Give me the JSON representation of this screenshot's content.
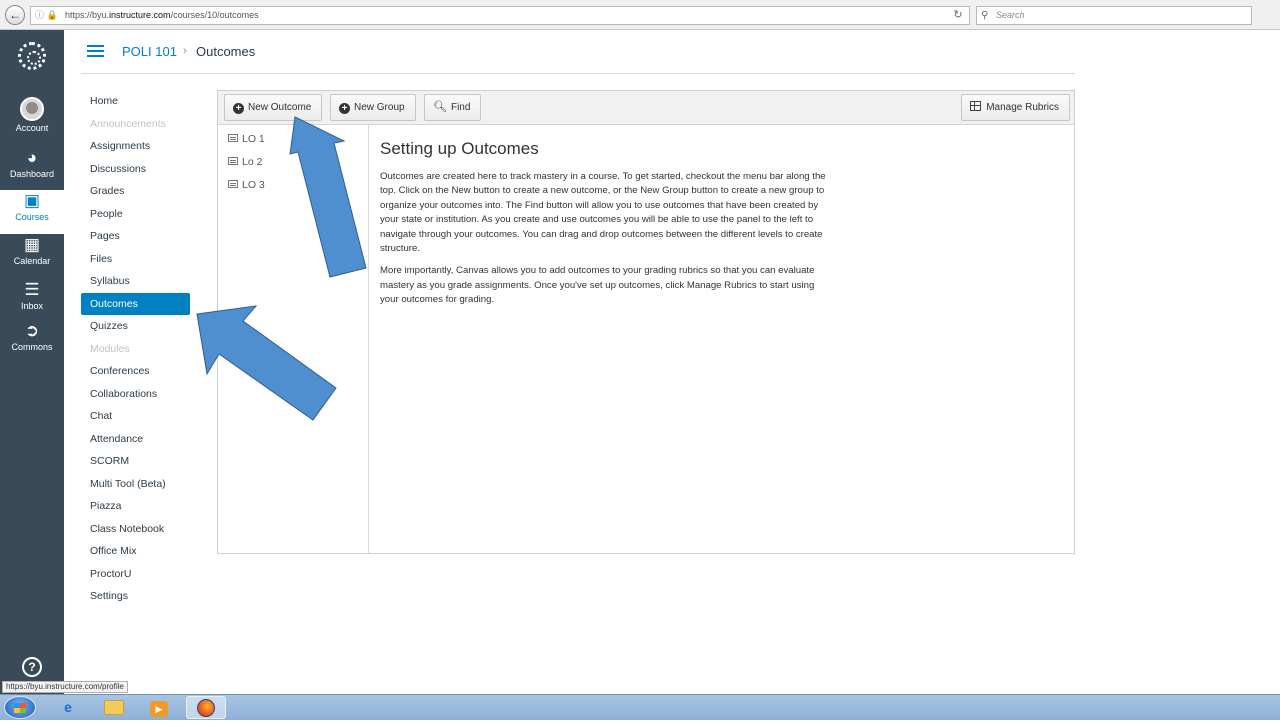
{
  "browser": {
    "url_prefix": "https://byu.",
    "url_domain": "instructure.com",
    "url_path": "/courses/10/outcomes",
    "search_placeholder": "Search",
    "status_url": "https://byu.instructure.com/profile"
  },
  "global_nav": [
    {
      "label": "Account",
      "icon": "avatar"
    },
    {
      "label": "Dashboard",
      "icon": "dashboard-icon"
    },
    {
      "label": "Courses",
      "icon": "courses-icon",
      "active": true
    },
    {
      "label": "Calendar",
      "icon": "calendar-icon"
    },
    {
      "label": "Inbox",
      "icon": "inbox-icon"
    },
    {
      "label": "Commons",
      "icon": "commons-icon"
    }
  ],
  "header": {
    "course": "POLI 101",
    "page": "Outcomes"
  },
  "course_nav": [
    {
      "label": "Home"
    },
    {
      "label": "Announcements",
      "disabled": true
    },
    {
      "label": "Assignments"
    },
    {
      "label": "Discussions"
    },
    {
      "label": "Grades"
    },
    {
      "label": "People"
    },
    {
      "label": "Pages"
    },
    {
      "label": "Files"
    },
    {
      "label": "Syllabus"
    },
    {
      "label": "Outcomes",
      "active": true
    },
    {
      "label": "Quizzes"
    },
    {
      "label": "Modules",
      "disabled": true
    },
    {
      "label": "Conferences"
    },
    {
      "label": "Collaborations"
    },
    {
      "label": "Chat"
    },
    {
      "label": "Attendance"
    },
    {
      "label": "SCORM"
    },
    {
      "label": "Multi Tool (Beta)"
    },
    {
      "label": "Piazza"
    },
    {
      "label": "Class Notebook"
    },
    {
      "label": "Office Mix"
    },
    {
      "label": "ProctorU"
    },
    {
      "label": "Settings"
    }
  ],
  "toolbar": {
    "new_outcome": "New Outcome",
    "new_group": "New Group",
    "find": "Find",
    "manage_rubrics": "Manage Rubrics"
  },
  "outcomes": [
    "LO 1",
    "Lo 2",
    "LO 3"
  ],
  "content": {
    "title": "Setting up Outcomes",
    "paragraph1": "Outcomes are created here to track mastery in a course. To get started, checkout the menu bar along the top. Click on the New button to create a new outcome, or the New Group button to create a new group to organize your outcomes into. The Find button will allow you to use outcomes that have been created by your state or institution. As you create and use outcomes you will be able to use the panel to the left to navigate through your outcomes. You can drag and drop outcomes between the different levels to create structure.",
    "paragraph2": "More importantly, Canvas allows you to add outcomes to your grading rubrics so that you can evaluate mastery as you grade assignments. Once you've set up outcomes, click Manage Rubrics to start using your outcomes for grading."
  },
  "colors": {
    "nav_bg": "#394b58",
    "brand": "#0081c2",
    "arrow_fill": "#4f8fcf",
    "arrow_stroke": "#2f5f8f"
  },
  "taskbar": [
    "start-button",
    "internet-explorer-icon",
    "folder-icon",
    "media-player-icon",
    "firefox-icon"
  ]
}
